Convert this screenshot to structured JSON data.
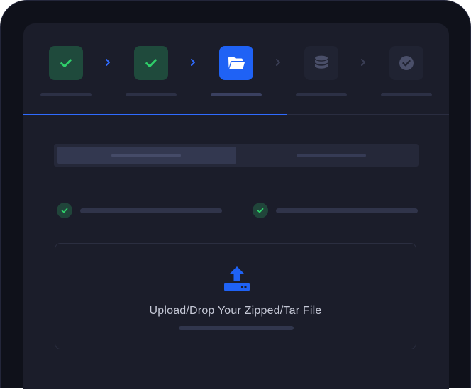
{
  "stepper": {
    "steps": [
      {
        "state": "done",
        "icon": "check-icon"
      },
      {
        "state": "done",
        "icon": "check-icon"
      },
      {
        "state": "active",
        "icon": "folder-open-icon"
      },
      {
        "state": "pending",
        "icon": "database-icon"
      },
      {
        "state": "pending",
        "icon": "check-circle-icon"
      }
    ],
    "progress_fraction": 0.62
  },
  "tabs": {
    "selected_index": 0,
    "count": 2
  },
  "checks": [
    {
      "state": "done",
      "icon": "check-icon"
    },
    {
      "state": "done",
      "icon": "check-icon"
    }
  ],
  "upload": {
    "label": "Upload/Drop Your Zipped/Tar File",
    "icon": "upload-icon"
  },
  "colors": {
    "accent": "#1f62f5",
    "success": "#2fd06a",
    "panel": "#1b1d2a",
    "background": "#0f111a"
  }
}
